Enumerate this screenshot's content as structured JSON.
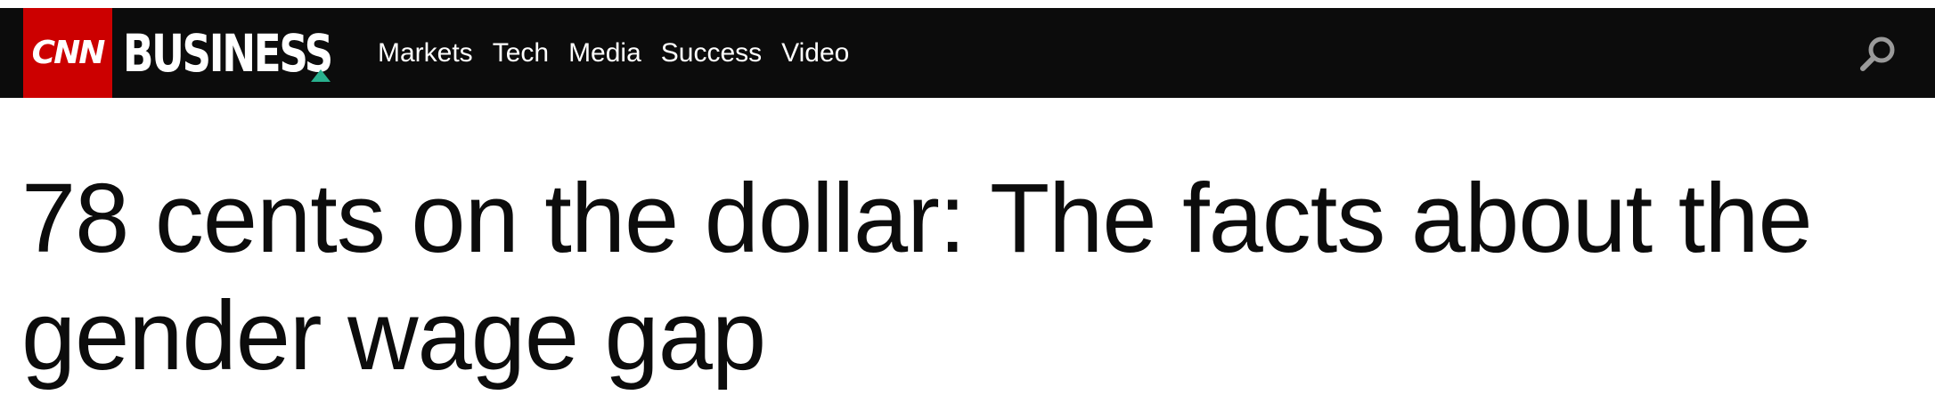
{
  "brand": {
    "cnn_logo": "CNN",
    "section_logo": "BUSINESS",
    "colors": {
      "cnn_red": "#cc0000",
      "navbar": "#0c0c0c",
      "accent_triangle": "#29b08e"
    }
  },
  "nav": {
    "items": [
      {
        "label": "Markets"
      },
      {
        "label": "Tech"
      },
      {
        "label": "Media"
      },
      {
        "label": "Success"
      },
      {
        "label": "Video"
      }
    ],
    "search_icon": "search-icon"
  },
  "article": {
    "headline": "78 cents on the dollar: The facts about the gender wage gap"
  }
}
